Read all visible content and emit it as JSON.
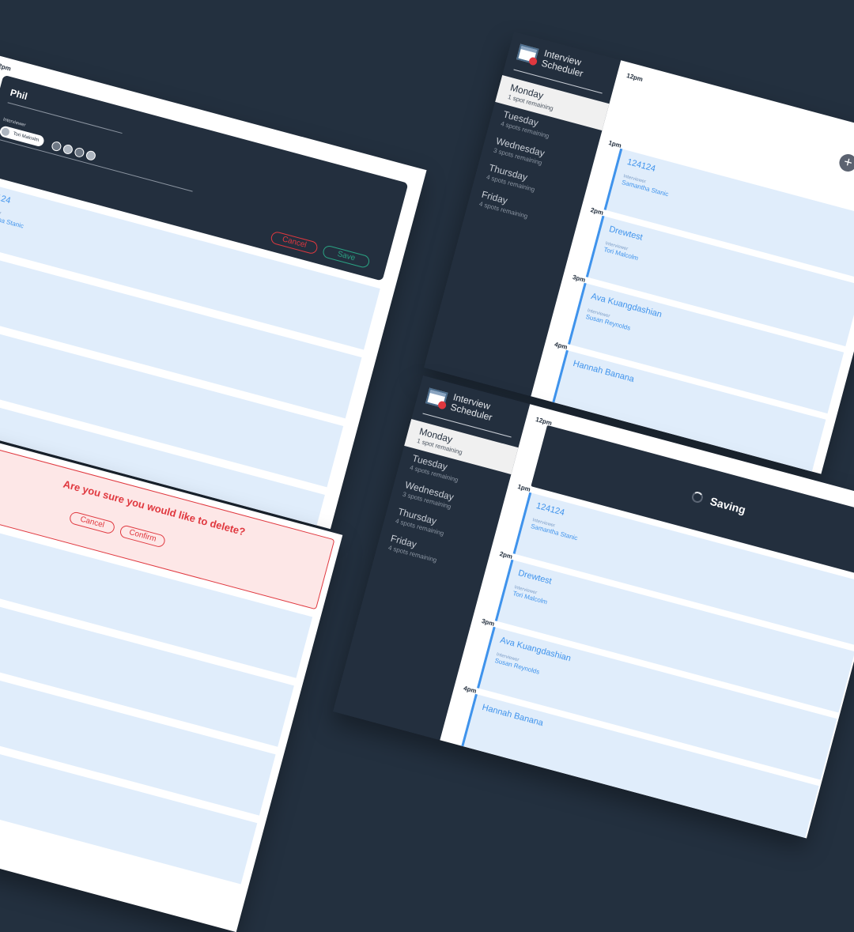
{
  "sidebar": {
    "brand_line1": "Interview",
    "brand_line2": "Scheduler",
    "days": [
      {
        "name": "Monday",
        "spots": "1 spot remaining"
      },
      {
        "name": "Tuesday",
        "spots": "4 spots remaining"
      },
      {
        "name": "Wednesday",
        "spots": "3 spots remaining"
      },
      {
        "name": "Thursday",
        "spots": "4 spots remaining"
      },
      {
        "name": "Friday",
        "spots": "4 spots remaining"
      }
    ]
  },
  "times": {
    "t12": "12pm",
    "t1": "1pm",
    "t2": "2pm",
    "t3": "3pm",
    "t4": "4pm"
  },
  "interviewer_label": "Interviewer",
  "appointments": [
    {
      "student": "124124",
      "interviewer": "Samantha Stanic"
    },
    {
      "student": "Drewtest",
      "interviewer": "Tori Malcolm"
    },
    {
      "student": "Ava Kuangdashian",
      "interviewer": "Susan Reynolds"
    },
    {
      "student": "Hannah Banana",
      "interviewer": ""
    }
  ],
  "form": {
    "student_name": "Phil",
    "interviewer_label": "Interviewer",
    "selected_interviewer": "Tori Malcolm",
    "cancel_label": "Cancel",
    "save_label": "Save",
    "student_fragment": "124124",
    "interviewer_fragment": "Samantha Stanic",
    "fragment_2": "ewtest",
    "fragment_2_int": "colm",
    "fragment_3": "gdashian"
  },
  "confirm": {
    "message": "Are you sure you would like to delete?",
    "cancel_label": "Cancel",
    "confirm_label": "Confirm"
  },
  "saving": {
    "label": "Saving"
  },
  "colors": {
    "background": "#23303f",
    "nav": "#232f3e",
    "accent": "#3f93ec",
    "slot": "#e0edfb",
    "danger": "#e0383f",
    "success": "#2aa383"
  },
  "icons": {
    "brand": "calendar-icon",
    "add": "plus-icon",
    "spinner": "spinner-icon"
  }
}
